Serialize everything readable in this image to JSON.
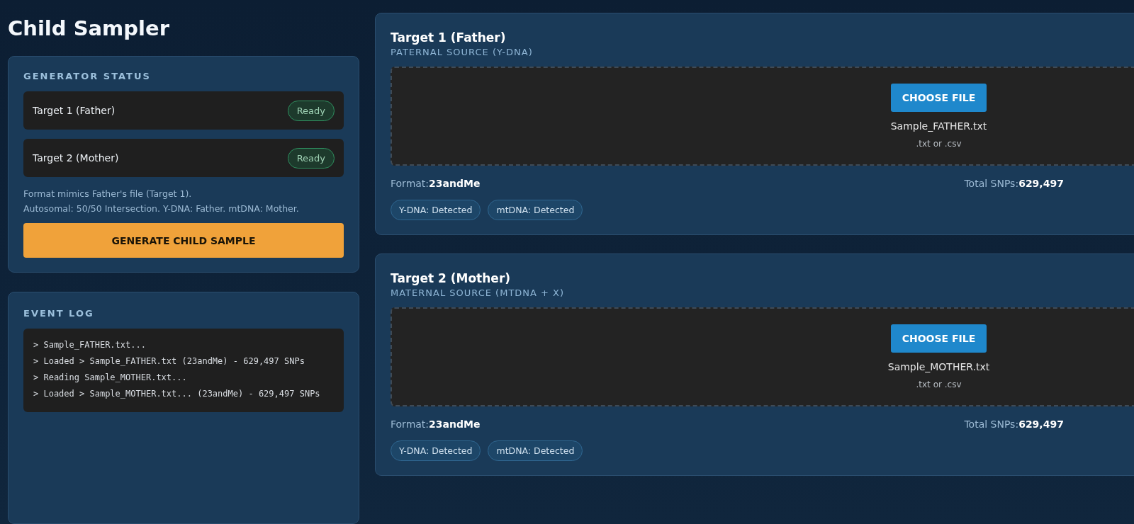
{
  "title": "Child Sampler",
  "generator_status": {
    "heading": "GENERATOR STATUS",
    "targets": [
      {
        "label": "Target 1 (Father)",
        "badge": "Ready"
      },
      {
        "label": "Target 2 (Mother)",
        "badge": "Ready"
      }
    ],
    "note_lines": [
      "Format mimics Father's file (Target 1).",
      "Autosomal: 50/50 Intersection. Y-DNA: Father. mtDNA: Mother."
    ],
    "button": "GENERATE CHILD SAMPLE"
  },
  "event_log": {
    "heading": "EVENT LOG",
    "entries": [
      "> Sample_FATHER.txt...",
      "> Loaded > Sample_FATHER.txt (23andMe) - 629,497 SNPs",
      "> Reading Sample_MOTHER.txt...",
      "> Loaded > Sample_MOTHER.txt... (23andMe) - 629,497 SNPs"
    ]
  },
  "targets": [
    {
      "title": "Target 1 (Father)",
      "subtitle": "PATERNAL SOURCE (Y-DNA)",
      "button": "CHOOSE FILE",
      "file_name": "Sample_FATHER.txt",
      "hint": ".txt or .csv",
      "format": "Format:**23andMe**",
      "total": "Total SNPs:**629,497**",
      "tags": [
        "Y-DNA: Detected",
        "mtDNA: Detected"
      ]
    },
    {
      "title": "Target 2 (Mother)",
      "subtitle": "MATERNAL SOURCE (MTDNA + X)",
      "button": "CHOOSE FILE",
      "file_name": "Sample_MOTHER.txt",
      "hint": ".txt or .csv",
      "format": "Format:**23andMe**",
      "total": "Total SNPs:**629,497**",
      "tags": [
        "Y-DNA: Detected",
        "mtDNA: Detected"
      ]
    }
  ]
}
